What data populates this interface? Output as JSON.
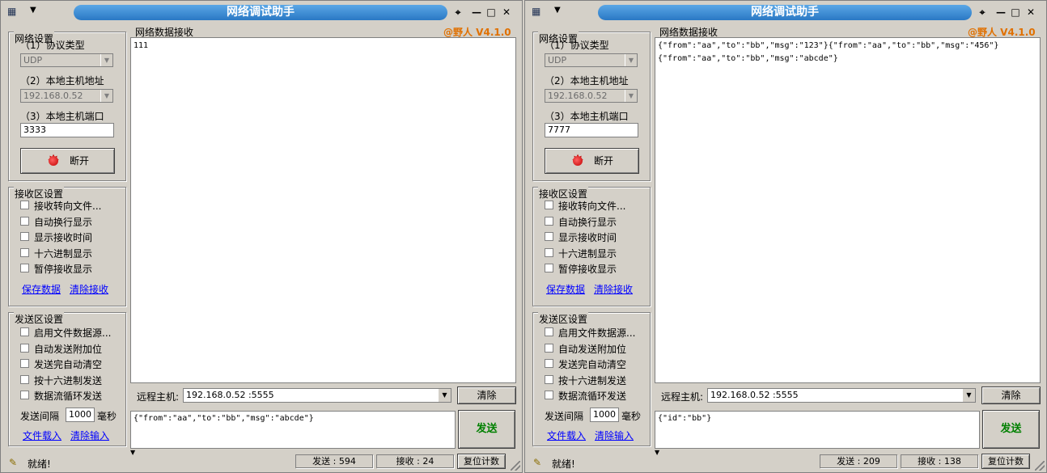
{
  "colors": {
    "title_bar": "#2a78c4",
    "version": "#e07000",
    "link": "#0000ff",
    "send_button": "#008000",
    "led": "#c00000"
  },
  "windows": [
    {
      "title": "网络调试助手",
      "version": "@野人 V4.1.0",
      "net": {
        "group_title": "网络设置",
        "protocol_label": "（1）协议类型",
        "protocol_value": "UDP",
        "host_label": "（2）本地主机地址",
        "host_value": "192.168.0.52",
        "port_label": "（3）本地主机端口",
        "port_value": "3333",
        "connect_label": "断开"
      },
      "recv_settings": {
        "group_title": "接收区设置",
        "options": [
          "接收转向文件...",
          "自动换行显示",
          "显示接收时间",
          "十六进制显示",
          "暂停接收显示"
        ],
        "save_link": "保存数据",
        "clear_link": "清除接收"
      },
      "send_settings": {
        "group_title": "发送区设置",
        "options": [
          "启用文件数据源...",
          "自动发送附加位",
          "发送完自动清空",
          "按十六进制发送",
          "数据流循环发送"
        ],
        "interval_label": "发送间隔",
        "interval_value": "1000",
        "interval_unit": "毫秒",
        "load_link": "文件载入",
        "clear_link": "清除输入"
      },
      "recv_area_label": "网络数据接收",
      "recv_lines": [
        "111"
      ],
      "remote_label": "远程主机:",
      "remote_value": "192.168.0.52 :5555",
      "clear_button": "清除",
      "send_text": "{\"from\":\"aa\",\"to\":\"bb\",\"msg\":\"abcde\"}",
      "send_button": "发送",
      "status": {
        "ready": "就绪!",
        "sent": "发送 : 594",
        "received": "接收 : 24",
        "reset": "复位计数"
      }
    },
    {
      "title": "网络调试助手",
      "version": "@野人 V4.1.0",
      "net": {
        "group_title": "网络设置",
        "protocol_label": "（1）协议类型",
        "protocol_value": "UDP",
        "host_label": "（2）本地主机地址",
        "host_value": "192.168.0.52",
        "port_label": "（3）本地主机端口",
        "port_value": "7777",
        "connect_label": "断开"
      },
      "recv_settings": {
        "group_title": "接收区设置",
        "options": [
          "接收转向文件...",
          "自动换行显示",
          "显示接收时间",
          "十六进制显示",
          "暂停接收显示"
        ],
        "save_link": "保存数据",
        "clear_link": "清除接收"
      },
      "send_settings": {
        "group_title": "发送区设置",
        "options": [
          "启用文件数据源...",
          "自动发送附加位",
          "发送完自动清空",
          "按十六进制发送",
          "数据流循环发送"
        ],
        "interval_label": "发送间隔",
        "interval_value": "1000",
        "interval_unit": "毫秒",
        "load_link": "文件载入",
        "clear_link": "清除输入"
      },
      "recv_area_label": "网络数据接收",
      "recv_lines": [
        "{\"from\":\"aa\",\"to\":\"bb\",\"msg\":\"123\"}{\"from\":\"aa\",\"to\":\"bb\",\"msg\":\"456\"}",
        "{\"from\":\"aa\",\"to\":\"bb\",\"msg\":\"abcde\"}"
      ],
      "remote_label": "远程主机:",
      "remote_value": "192.168.0.52 :5555",
      "clear_button": "清除",
      "send_text": "{\"id\":\"bb\"}",
      "send_button": "发送",
      "status": {
        "ready": "就绪!",
        "sent": "发送 : 209",
        "received": "接收 : 138",
        "reset": "复位计数"
      }
    }
  ]
}
